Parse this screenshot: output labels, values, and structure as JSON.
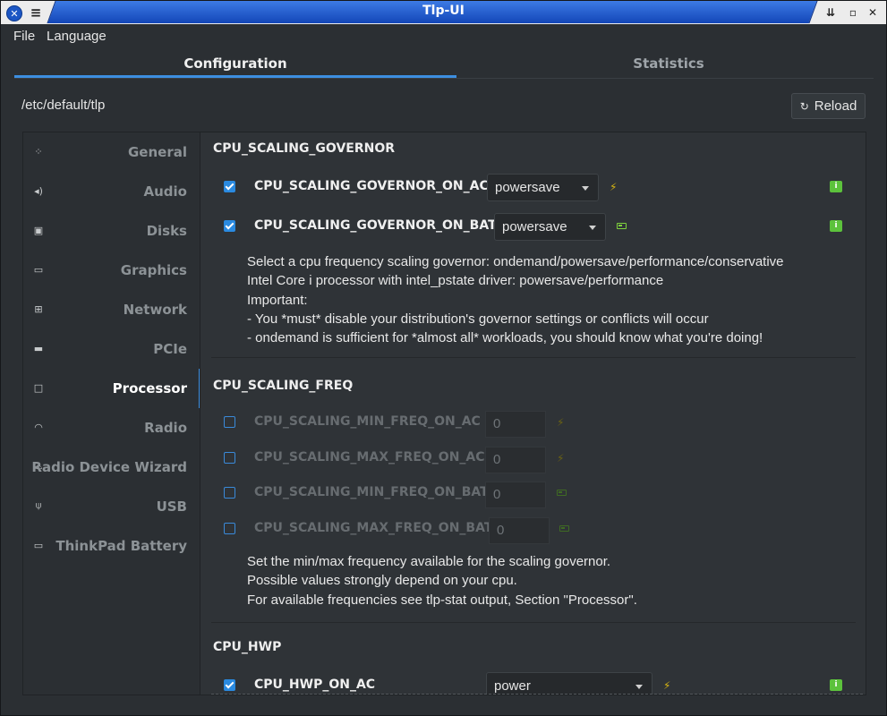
{
  "window": {
    "title": "Tlp-UI"
  },
  "menu": {
    "file": "File",
    "language": "Language"
  },
  "tabs": [
    {
      "label": "Configuration",
      "active": true
    },
    {
      "label": "Statistics",
      "active": false
    }
  ],
  "config_path": "/etc/default/tlp",
  "reload_label": "Reload",
  "sidebar": [
    {
      "label": "General",
      "icon": "grid-icon"
    },
    {
      "label": "Audio",
      "icon": "speaker-icon"
    },
    {
      "label": "Disks",
      "icon": "disk-icon"
    },
    {
      "label": "Graphics",
      "icon": "monitor-icon"
    },
    {
      "label": "Network",
      "icon": "network-icon"
    },
    {
      "label": "PCIe",
      "icon": "pcie-icon"
    },
    {
      "label": "Processor",
      "icon": "processor-icon",
      "active": true
    },
    {
      "label": "Radio",
      "icon": "wifi-icon"
    },
    {
      "label": "Radio Device Wizard",
      "icon": "wizard-icon"
    },
    {
      "label": "USB",
      "icon": "usb-icon"
    },
    {
      "label": "ThinkPad Battery",
      "icon": "battery-icon"
    }
  ],
  "sections": {
    "governor": {
      "title": "CPU_SCALING_GOVERNOR",
      "ac": {
        "name": "CPU_SCALING_GOVERNOR_ON_AC",
        "checked": true,
        "value": "powersave"
      },
      "bat": {
        "name": "CPU_SCALING_GOVERNOR_ON_BAT",
        "checked": true,
        "value": "powersave"
      },
      "desc": [
        "Select a cpu frequency scaling governor: ondemand/powersave/performance/conservative",
        "Intel Core i processor with intel_pstate driver: powersave/performance",
        "Important:",
        "- You *must* disable your distribution's governor settings or conflicts will occur",
        "- ondemand is sufficient for *almost all* workloads, you should know what you're doing!"
      ]
    },
    "freq": {
      "title": "CPU_SCALING_FREQ",
      "items": [
        {
          "name": "CPU_SCALING_MIN_FREQ_ON_AC",
          "checked": false,
          "value": "0"
        },
        {
          "name": "CPU_SCALING_MAX_FREQ_ON_AC",
          "checked": false,
          "value": "0"
        },
        {
          "name": "CPU_SCALING_MIN_FREQ_ON_BAT",
          "checked": false,
          "value": "0"
        },
        {
          "name": "CPU_SCALING_MAX_FREQ_ON_BAT",
          "checked": false,
          "value": "0"
        }
      ],
      "desc": [
        "Set the min/max frequency available for the scaling governor.",
        "Possible values strongly depend on your cpu.",
        "For available frequencies see tlp-stat output, Section \"Processor\"."
      ]
    },
    "hwp": {
      "title": "CPU_HWP",
      "ac": {
        "name": "CPU_HWP_ON_AC",
        "checked": true,
        "value": "power"
      }
    }
  },
  "colors": {
    "accent": "#3d8ee0",
    "title_bar": "#1c56c4",
    "ac_bolt": "#d7b512",
    "battery": "#7fd13d",
    "badge": "#5cc23c"
  }
}
